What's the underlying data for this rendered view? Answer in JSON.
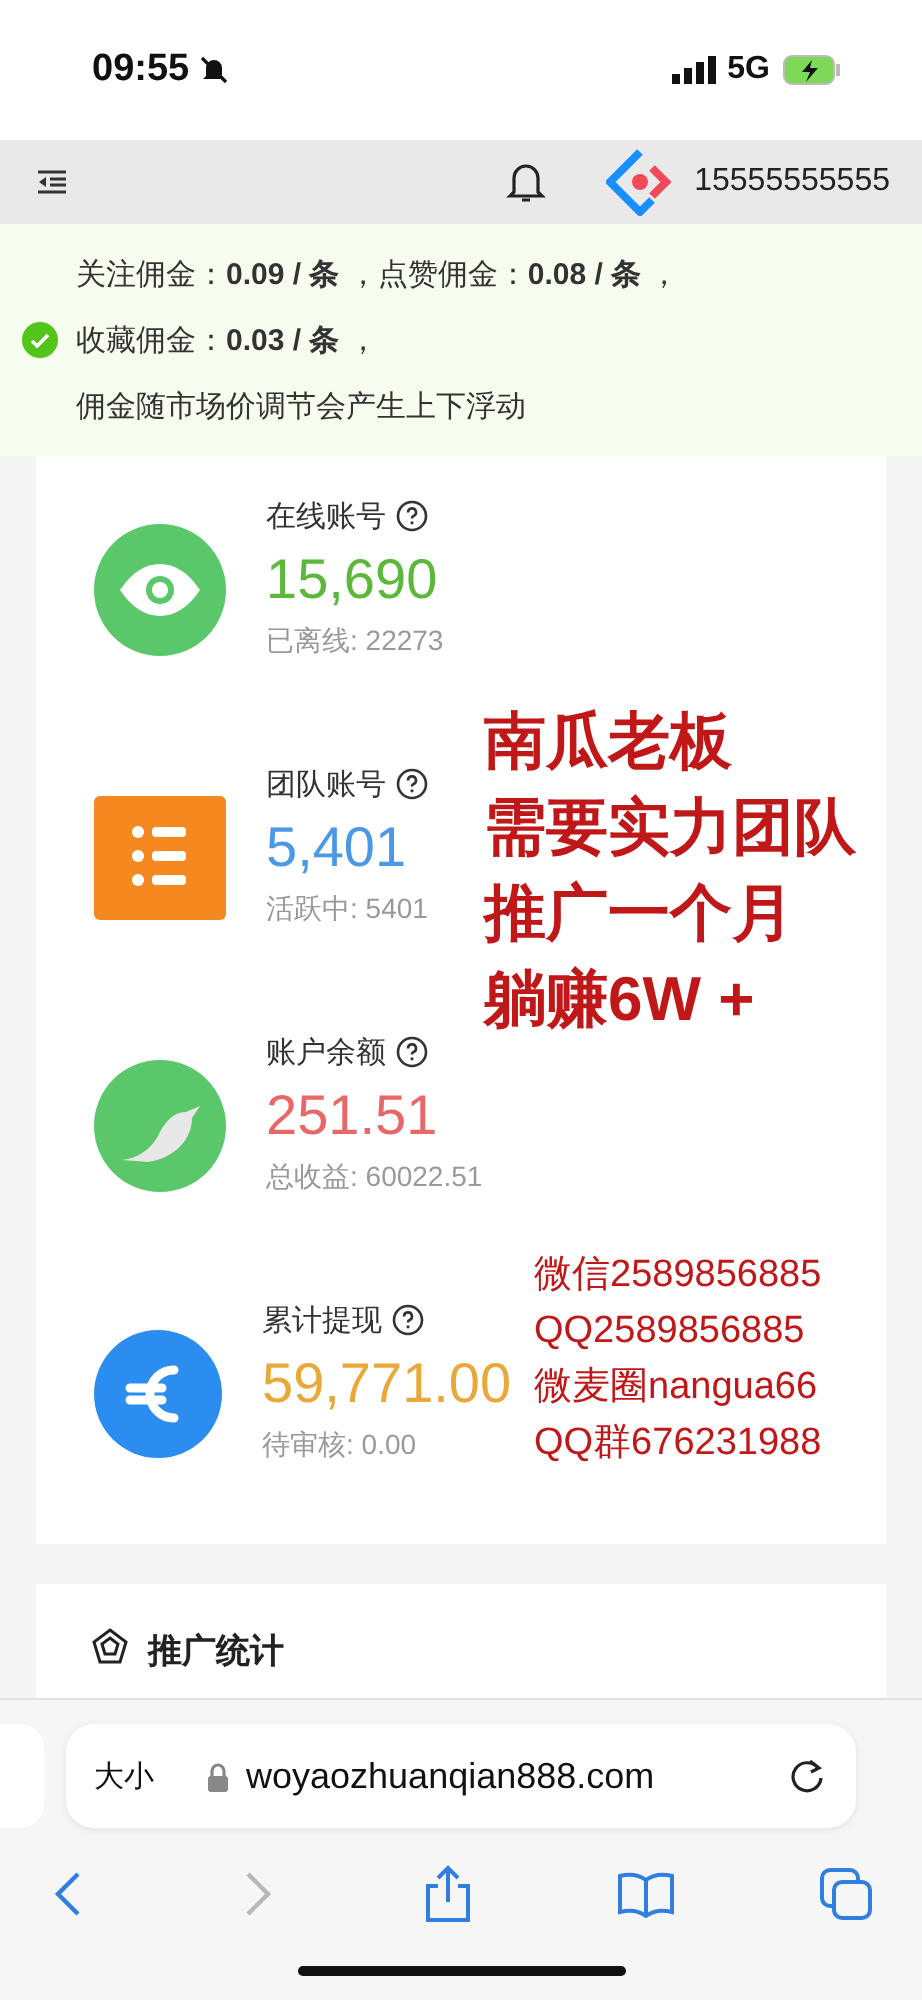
{
  "status_bar": {
    "time": "09:55",
    "network": "5G"
  },
  "header": {
    "phone": "15555555555"
  },
  "notice": {
    "lines": [
      "关注佣金：**0.09 / 条** ，点赞佣金：**0.08 / 条** ，",
      "收藏佣金：**0.03 / 条** ，",
      "佣金随市场价调节会产生上下浮动"
    ]
  },
  "stats": [
    {
      "kind": "eye",
      "label": "在线账号",
      "value": "15,690",
      "color": "#5cb83a",
      "sub": "已离线: 22273"
    },
    {
      "kind": "list",
      "label": "团队账号",
      "value": "5,401",
      "color": "#4a98e6",
      "sub": "活跃中: 5401"
    },
    {
      "kind": "bird",
      "label": "账户余额",
      "value": "251.51",
      "color": "#e8686a",
      "sub": "总收益: 60022.51"
    },
    {
      "kind": "euro",
      "label": "累计提现",
      "value": "59,771.00",
      "color": "#e9a93a",
      "sub": "待审核: 0.00"
    }
  ],
  "overlay": {
    "headline": [
      "南瓜老板",
      "需要实力团队",
      "推广一个月",
      "躺赚6W +"
    ],
    "contacts": [
      "微信2589856885",
      "QQ2589856885",
      "微麦圈nangua66",
      "QQ群676231988"
    ]
  },
  "section": {
    "title": "推广统计"
  },
  "browser": {
    "text_size": "大小",
    "url": "woyaozhuanqian888.com"
  }
}
